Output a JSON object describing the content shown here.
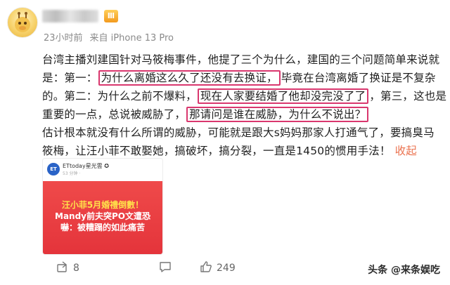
{
  "post": {
    "meta_time": "23小时前",
    "meta_source": "来自 iPhone 13 Pro",
    "level_badge": "Ⅲ",
    "verified_badge": "v",
    "lines": [
      {
        "segments": [
          {
            "text": "台湾主播刘建国针对马筱梅事件，他提了三个为什么，建国的三个问题简单来说就"
          }
        ]
      },
      {
        "segments": [
          {
            "text": "是：第一："
          },
          {
            "text": "为什么离婚这么久了还没有去换证，",
            "highlight": true
          },
          {
            "text": "毕竟在台湾离婚了换证是不复杂"
          }
        ]
      },
      {
        "segments": [
          {
            "text": "的。第二：为什么之前不爆料，"
          },
          {
            "text": "现在人家要结婚了他却没完没了了",
            "highlight": true
          },
          {
            "text": "，第三，这也是"
          }
        ]
      },
      {
        "segments": [
          {
            "text": "重要的一点，总说被威胁了，"
          },
          {
            "text": "那请问是谁在威胁，为什么不说出？",
            "highlight": true
          }
        ]
      },
      {
        "segments": [
          {
            "text": "估计根本就没有什么所谓的威胁，可能就是跟大s妈妈那家人打通气了，要搞臭马"
          }
        ]
      },
      {
        "segments": [
          {
            "text": "筱梅，让汪小菲不敢娶她，搞破坏，搞分裂，一直是1450的惯用手法！"
          }
        ]
      }
    ],
    "collapse_label": "收起"
  },
  "card": {
    "logo_text": "ET",
    "account_name": "ETtoday星光雲 ✪",
    "account_sub": "53 分钟 ·",
    "headline": [
      "汪小菲5月婚禮倒數！",
      "Mandy前夫突PO文遭恐",
      "嚇：被糟蹋的如此痛苦"
    ]
  },
  "actions": {
    "share_count": "8",
    "comment_count": "",
    "like_count": "249"
  },
  "watermark": "头条 @来条娱吃",
  "colors": {
    "highlight": "#d9376e",
    "collapse": "#eb7350",
    "banner": "#e4343b"
  }
}
